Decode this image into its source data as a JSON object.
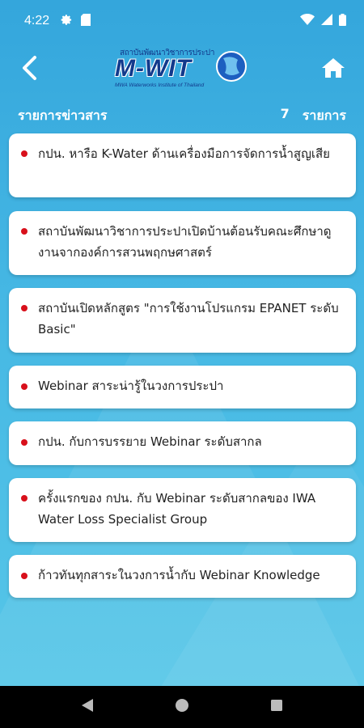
{
  "status": {
    "time": "4:22",
    "left_icons": [
      "gear-icon",
      "sd-card-icon"
    ],
    "right_icons": [
      "wifi-icon",
      "signal-icon",
      "battery-icon"
    ]
  },
  "header": {
    "logo": {
      "top_text": "สถาบันพัฒนาวิชาการประปา",
      "main_text": "M-WIT",
      "sub_text": "MWA Waterworks Institute of Thailand"
    },
    "back_icon": "chevron-left-icon",
    "home_icon": "home-icon"
  },
  "list_header": {
    "title": "รายการข่าวสาร",
    "count": "7",
    "unit": "รายการ"
  },
  "news": [
    {
      "title": "กปน. หารือ K-Water ด้านเครื่องมือการจัดการน้ำสูญเสีย"
    },
    {
      "title": "สถาบันพัฒนาวิชาการประปาเปิดบ้านต้อนรับคณะศึกษาดูงานจากองค์การสวนพฤกษศาสตร์"
    },
    {
      "title": "สถาบันเปิดหลักสูตร \"การใช้งานโปรแกรม EPANET ระดับ Basic\""
    },
    {
      "title": "Webinar สาระน่ารู้ในวงการประปา"
    },
    {
      "title": "กปน. กับการบรรยาย Webinar ระดับสากล"
    },
    {
      "title": "ครั้งแรกของ กปน. กับ Webinar ระดับสากลของ IWA Water Loss Specialist Group"
    },
    {
      "title": "ก้าวทันทุกสาระในวงการน้ำกับ Webinar Knowledge"
    }
  ],
  "colors": {
    "background": "#3fb0e0",
    "bullet": "#d8101b",
    "logo": "#123a8c"
  },
  "nav": [
    "back-triangle-icon",
    "home-circle-icon",
    "recents-square-icon"
  ]
}
